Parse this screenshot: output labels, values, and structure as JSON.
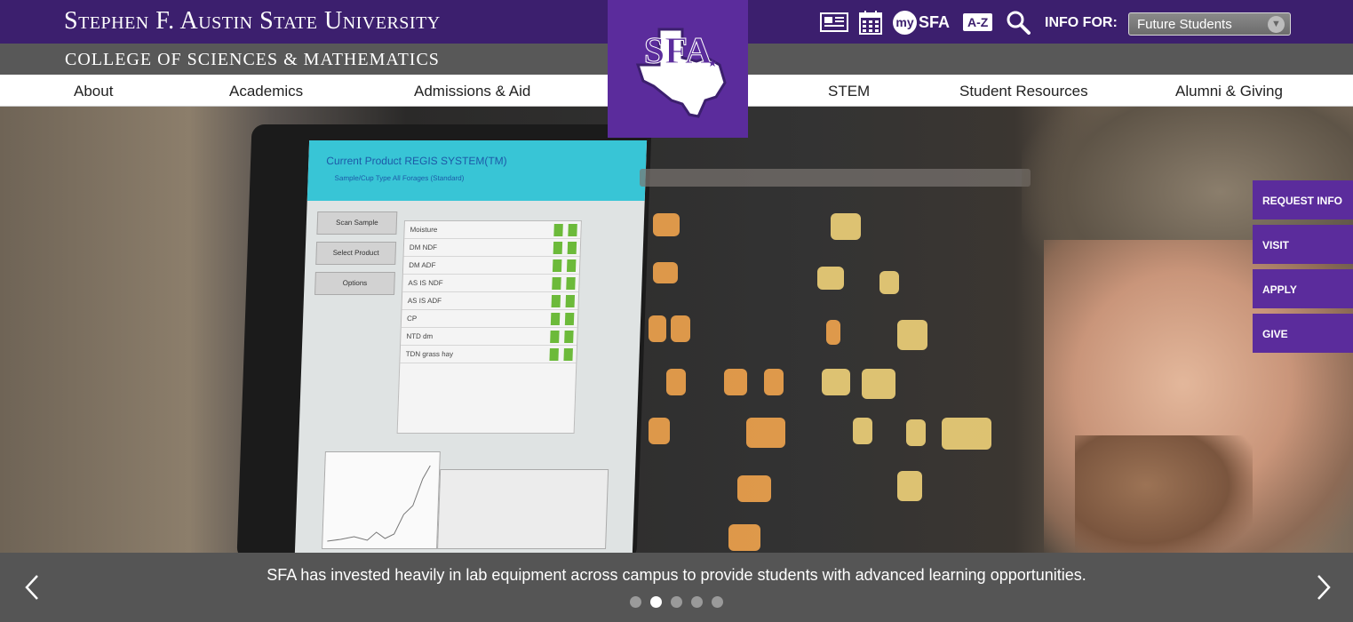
{
  "header": {
    "university_title": "Stephen F. Austin State University",
    "college_title": "COLLEGE OF SCIENCES & MATHEMATICS",
    "mysfa_label": "SFA",
    "mysfa_prefix": "my",
    "az_label": "A-Z",
    "info_for_label": "INFO FOR:",
    "info_for_selected": "Future Students",
    "icons": [
      "news-icon",
      "calendar-icon",
      "mysfa-icon",
      "az-index-icon",
      "search-icon"
    ]
  },
  "nav": {
    "items": [
      "About",
      "Academics",
      "Admissions & Aid",
      "STEM",
      "Student Resources",
      "Alumni & Giving"
    ]
  },
  "logo": {
    "text": "SFA"
  },
  "side_tabs": [
    "REQUEST INFO",
    "VISIT",
    "APPLY",
    "GIVE"
  ],
  "hero": {
    "screen": {
      "title": "Current Product  REGIS SYSTEM(TM)",
      "subtitle": "Sample/Cup Type   All Forages (Standard)",
      "buttons": [
        "Scan Sample",
        "Select Product",
        "Options"
      ],
      "rows": [
        "Moisture",
        "DM NDF",
        "DM ADF",
        "AS IS NDF",
        "AS IS ADF",
        "CP",
        "NTD dm",
        "TDN grass hay"
      ]
    },
    "caption": "SFA has invested heavily in lab equipment across campus to provide students with advanced learning opportunities.",
    "slide_count": 5,
    "active_slide": 2
  },
  "colors": {
    "purple_dark": "#3c1f6e",
    "purple": "#5b2c9c",
    "gray_band": "#585858",
    "caption_band": "#555555"
  }
}
